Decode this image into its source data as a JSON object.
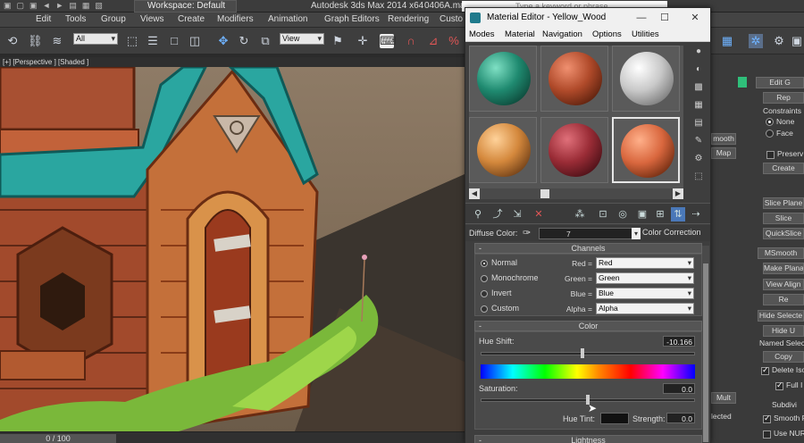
{
  "titlebar": {
    "workspace_label": "Workspace: Default",
    "app_title": "Autodesk 3ds Max  2014 x64",
    "file_title": "0406A.max",
    "search_placeholder": "Type a keyword or phrase"
  },
  "menubar": {
    "items": [
      "Edit",
      "Tools",
      "Group",
      "Views",
      "Create",
      "Modifiers",
      "Animation",
      "Graph Editors",
      "Rendering",
      "Custo"
    ]
  },
  "toolbar": {
    "selection_filter": "All",
    "reference_coord": "View"
  },
  "viewport": {
    "label": "[+] [Perspective ] [Shaded ]"
  },
  "timeline": {
    "frame_label": "0 / 100"
  },
  "material_editor": {
    "title": "Material Editor - Yellow_Wood",
    "menu": [
      "Modes",
      "Material",
      "Navigation",
      "Options",
      "Utilities"
    ],
    "slot_colors": [
      "#1f8a70",
      "#b04a2a",
      "#c8c8c8",
      "#d4883c",
      "#9a2c36",
      "#d9673e"
    ],
    "diffuse_label": "Diffuse Color:",
    "map_name": "7",
    "color_correction_label": "Color Correction",
    "channels_header": "Channels",
    "channels": [
      {
        "mode": "Normal",
        "channel": "Red =",
        "value": "Red",
        "selected": true
      },
      {
        "mode": "Monochrome",
        "channel": "Green =",
        "value": "Green",
        "selected": false
      },
      {
        "mode": "Invert",
        "channel": "Blue =",
        "value": "Blue",
        "selected": false
      },
      {
        "mode": "Custom",
        "channel": "Alpha =",
        "value": "Alpha",
        "selected": false
      }
    ],
    "color_header": "Color",
    "hue_shift_label": "Hue Shift:",
    "hue_shift_value": "-10.166",
    "saturation_label": "Saturation:",
    "saturation_value": "0.0",
    "hue_tint_label": "Hue Tint:",
    "strength_label": "Strength:",
    "strength_value": "0.0",
    "lightness_header": "Lightness"
  },
  "right_panel": {
    "edit_geometry": "Edit G",
    "repeat": "Rep",
    "constraints": "Constraints",
    "none": "None",
    "face": "Face",
    "preserve": "Preserv",
    "create": "Create",
    "smooth": "mooth",
    "map": "Map",
    "slice_plane": "Slice Plane",
    "slice": "Slice",
    "quickslice": "QuickSlice",
    "msmooth": "MSmooth",
    "make_planar": "Make Plana",
    "view_align": "View Align",
    "re": "Re",
    "hide_selected": "Hide Selecte",
    "hide_u": "Hide U",
    "named_select": "Named Select",
    "copy": "Copy",
    "delete_iso": "Delete Iso",
    "full": "Full I",
    "subdiv": "Subdivi",
    "smooth_r": "Smooth R",
    "use_nurms": "Use NUR",
    "mult": "Mult",
    "lected": "lected"
  }
}
